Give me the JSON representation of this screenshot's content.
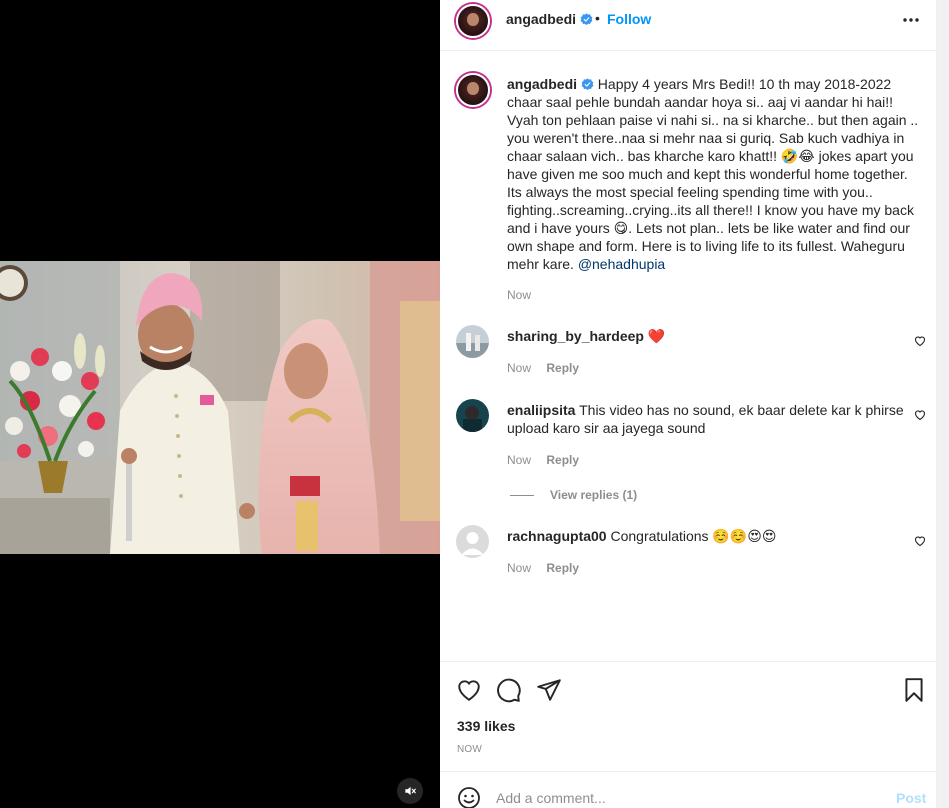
{
  "header": {
    "username": "angadbedi",
    "separator": "•",
    "follow_label": "Follow"
  },
  "caption": {
    "username": "angadbedi",
    "text": "Happy 4 years Mrs Bedi!! 10 th may 2018-2022 chaar saal pehle bundah aandar hoya si.. aaj vi aandar hi hai!! Vyah ton pehlaan paise vi nahi si.. na si kharche.. but then again .. you weren't there..naa si mehr naa si guriq. Sab kuch vadhiya in chaar salaan vich.. bas kharche karo khatt!! 🤣😂 jokes apart you have given me soo much and kept this wonderful home together. Its always the most special feeling spending time with you.. fighting..screaming..crying..its all there!! I know you have my back and i have yours 😋. Lets not plan.. lets be like water and find our own shape and form. Here is to living life to its fullest. Waheguru mehr kare.",
    "mention": "@nehadhupia",
    "time": "Now"
  },
  "comments": [
    {
      "username": "sharing_by_hardeep",
      "text": "❤️",
      "time": "Now",
      "reply_label": "Reply"
    },
    {
      "username": "enaliipsita",
      "text": "This video has no sound, ek baar delete kar k phirse upload karo sir aa jayega sound",
      "time": "Now",
      "reply_label": "Reply"
    },
    {
      "username": "rachnagupta00",
      "text": "Congratulations ☺️☺️😍😍",
      "time": "Now",
      "reply_label": "Reply"
    }
  ],
  "view_replies_label": "View replies (1)",
  "likes": "339 likes",
  "post_time": "NOW",
  "add_comment": {
    "placeholder": "Add a comment...",
    "post_label": "Post"
  },
  "icons": {
    "verified": "verified-badge-icon",
    "more": "more-options-icon",
    "like": "heart-icon",
    "comment": "comment-icon",
    "share": "share-icon",
    "save": "bookmark-icon",
    "emoji": "emoji-icon",
    "mute": "muted-speaker-icon"
  },
  "colors": {
    "accent": "#0095f6",
    "verified": "#3897f0",
    "heart_red": "#ed4956",
    "post_disabled": "#b2dffc",
    "muted_text": "#8e8e8e"
  }
}
